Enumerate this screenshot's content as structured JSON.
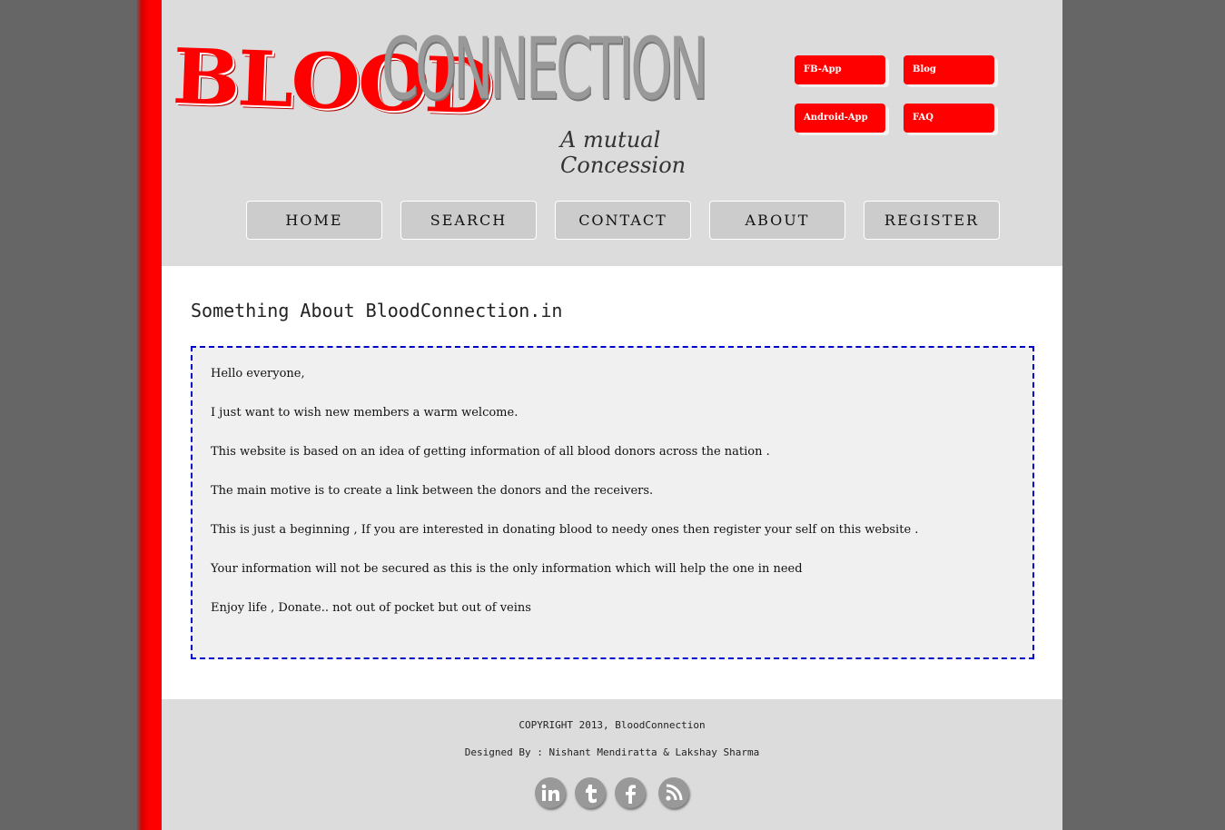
{
  "logo": {
    "word1": "BLOOD",
    "word2": "CONNECTION",
    "tagline": "A mutual Concession"
  },
  "quick_links": [
    {
      "label": "FB-App"
    },
    {
      "label": "Blog"
    },
    {
      "label": "Android-App"
    },
    {
      "label": "FAQ"
    }
  ],
  "nav": [
    {
      "label": "HOME"
    },
    {
      "label": "SEARCH"
    },
    {
      "label": "CONTACT"
    },
    {
      "label": "ABOUT"
    },
    {
      "label": "REGISTER"
    }
  ],
  "content": {
    "title": "Something About BloodConnection.in",
    "paragraphs": [
      "Hello everyone,",
      "I just want to wish new members a warm welcome.",
      "This website is based on an idea of getting information of all blood donors across the nation .",
      "The main motive is to create a link between the donors and the receivers.",
      "This is just a beginning , If you are interested in donating blood to needy ones then register your self on this website .",
      "Your information will not be secured as this is the only information which will help the one in need",
      "Enjoy life , Donate.. not out of pocket but out of veins"
    ]
  },
  "footer": {
    "copyright": "COPYRIGHT 2013, BloodConnection",
    "designed_by": "Designed By : Nishant Mendiratta & Lakshay Sharma"
  },
  "social_icons": [
    "linkedin-icon",
    "tumblr-icon",
    "facebook-icon",
    "rss-icon"
  ],
  "colors": {
    "accent": "#ff0000",
    "header_bg": "#dcdcdc",
    "box_border": "#0000cc",
    "page_bg": "#666666"
  }
}
